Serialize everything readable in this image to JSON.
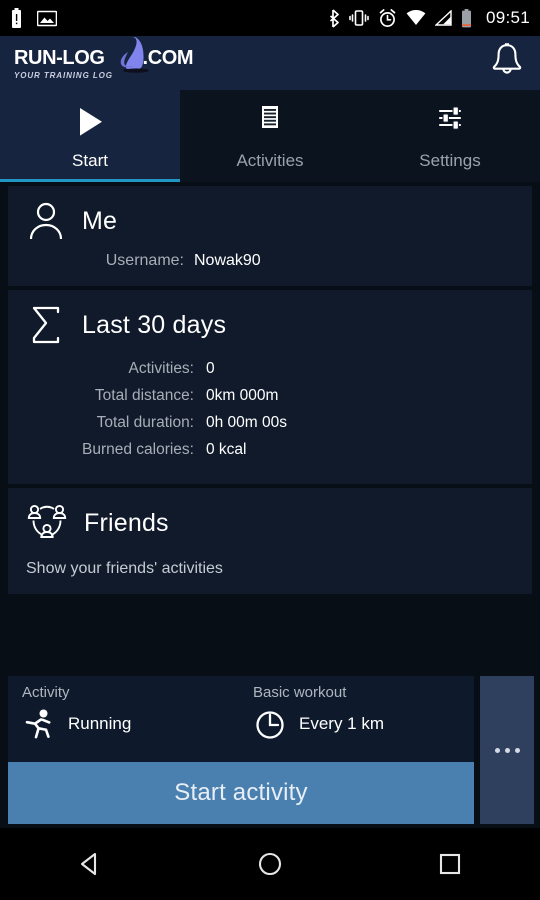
{
  "statusbar": {
    "time": "09:51",
    "left_icons": [
      "battery-alert-icon",
      "image-icon"
    ],
    "right_icons": [
      "bluetooth-icon",
      "vibrate-icon",
      "alarm-icon",
      "wifi-icon",
      "cell-signal-icon",
      "battery-icon"
    ]
  },
  "header": {
    "logo_text": "RUN-LOG",
    "logo_suffix": ".COM",
    "tagline": "YOUR TRAINING LOG",
    "notification_icon": "bell-icon",
    "background": "#16243f",
    "shoe_color": "#7b7ee8"
  },
  "tabs": [
    {
      "label": "Start",
      "icon": "play-icon",
      "active": true
    },
    {
      "label": "Activities",
      "icon": "document-list-icon",
      "active": false
    },
    {
      "label": "Settings",
      "icon": "sliders-icon",
      "active": false
    }
  ],
  "accent_color": "#2196c4",
  "cards": {
    "me": {
      "title": "Me",
      "icon": "person-icon",
      "username_label": "Username:",
      "username_value": "Nowak90"
    },
    "last30": {
      "title": "Last 30 days",
      "icon": "sigma-icon",
      "rows": [
        {
          "label": "Activities:",
          "value": "0"
        },
        {
          "label": "Total distance:",
          "value": "0km 000m"
        },
        {
          "label": "Total duration:",
          "value": "0h 00m 00s"
        },
        {
          "label": "Burned calories:",
          "value": "0 kcal"
        }
      ]
    },
    "friends": {
      "title": "Friends",
      "icon": "friends-group-icon",
      "subtitle": "Show your friends' activities"
    }
  },
  "bottom": {
    "activity": {
      "label": "Activity",
      "icon": "running-icon",
      "value": "Running"
    },
    "workout": {
      "label": "Basic workout",
      "icon": "clock-icon",
      "value": "Every 1 km"
    },
    "start_button": "Start activity",
    "start_button_color": "#4a80b0",
    "overflow_icon": "more-options-icon"
  },
  "navbar": {
    "back": "back-triangle-icon",
    "home": "home-circle-icon",
    "recents": "recents-square-icon"
  }
}
